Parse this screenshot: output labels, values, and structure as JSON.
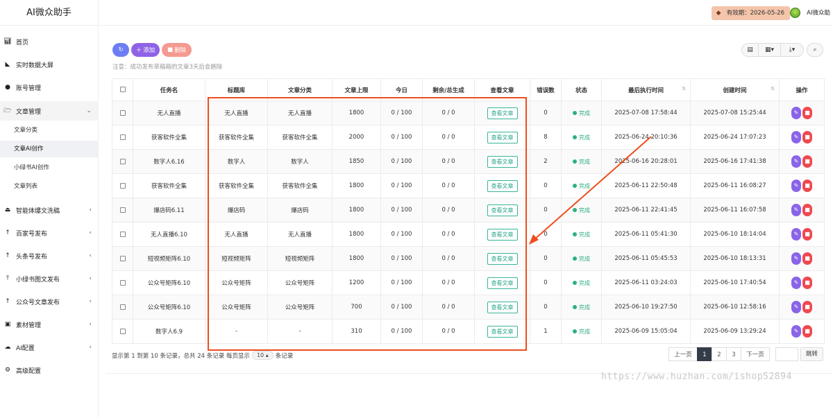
{
  "app": {
    "title": "AI微众助手"
  },
  "topbar": {
    "expiry_label": "有效期：2026-05-26",
    "username": "AI微众助"
  },
  "sidebar": {
    "items": [
      {
        "label": "首页",
        "icon": "bar-chart-icon"
      },
      {
        "label": "实时数据大屏",
        "icon": "area-chart-icon"
      },
      {
        "label": "账号管理",
        "icon": "wechat-icon"
      },
      {
        "label": "文章管理",
        "icon": "folder-open-icon"
      },
      {
        "label": "智能体爆文洗稿",
        "icon": "eject-icon"
      },
      {
        "label": "百家号发布",
        "icon": "arrow-up-icon"
      },
      {
        "label": "头条号发布",
        "icon": "arrow-up-icon"
      },
      {
        "label": "小绿书图文发布",
        "icon": "upload-icon"
      },
      {
        "label": "公众号文章发布",
        "icon": "arrow-up-icon"
      },
      {
        "label": "素材管理",
        "icon": "image-icon"
      },
      {
        "label": "AI配置",
        "icon": "cloud-icon"
      },
      {
        "label": "高级配置",
        "icon": "gear-icon"
      }
    ],
    "sub_items": [
      "文章分类",
      "文章AI创作",
      "小绿书AI创作",
      "文章列表"
    ]
  },
  "toolbar": {
    "add_label": "添加",
    "delete_label": "删除",
    "notice": "注意：成功发布草稿箱的文章3天后会删除"
  },
  "table": {
    "headers": [
      "任务名",
      "标题库",
      "文章分类",
      "文章上限",
      "今日",
      "剩余/总生成",
      "查看文章",
      "错误数",
      "状态",
      "最后执行时间",
      "创建时间",
      "操作"
    ],
    "view_label": "查看文章",
    "rows": [
      {
        "name": "无人直播",
        "title_lib": "无人直播",
        "category": "无人直播",
        "limit": "1800",
        "today": "0 / 100",
        "remain": "0 / 0",
        "errors": "0",
        "status": "完成",
        "last_run": "2025-07-08 17:58:44",
        "created": "2025-07-08 15:25:44"
      },
      {
        "name": "获客软件全集",
        "title_lib": "获客软件全集",
        "category": "获客软件全集",
        "limit": "2000",
        "today": "0 / 100",
        "remain": "0 / 0",
        "errors": "8",
        "status": "完成",
        "last_run": "2025-06-24 20:10:36",
        "created": "2025-06-24 17:07:23"
      },
      {
        "name": "数字人6.16",
        "title_lib": "数字人",
        "category": "数字人",
        "limit": "1850",
        "today": "0 / 100",
        "remain": "0 / 0",
        "errors": "2",
        "status": "完成",
        "last_run": "2025-06-16 20:28:01",
        "created": "2025-06-16 17:41:38"
      },
      {
        "name": "获客软件全集",
        "title_lib": "获客软件全集",
        "category": "获客软件全集",
        "limit": "1800",
        "today": "0 / 100",
        "remain": "0 / 0",
        "errors": "0",
        "status": "完成",
        "last_run": "2025-06-11 22:50:48",
        "created": "2025-06-11 16:08:27"
      },
      {
        "name": "爆店码6.11",
        "title_lib": "爆店码",
        "category": "爆店码",
        "limit": "1800",
        "today": "0 / 100",
        "remain": "0 / 0",
        "errors": "0",
        "status": "完成",
        "last_run": "2025-06-11 22:41:45",
        "created": "2025-06-11 16:07:58"
      },
      {
        "name": "无人直播6.10",
        "title_lib": "无人直播",
        "category": "无人直播",
        "limit": "1800",
        "today": "0 / 100",
        "remain": "0 / 0",
        "errors": "0",
        "status": "完成",
        "last_run": "2025-06-11 05:41:30",
        "created": "2025-06-10 18:14:04"
      },
      {
        "name": "短视频矩阵6.10",
        "title_lib": "短视频矩阵",
        "category": "短视频矩阵",
        "limit": "1800",
        "today": "0 / 100",
        "remain": "0 / 0",
        "errors": "0",
        "status": "完成",
        "last_run": "2025-06-11 05:45:53",
        "created": "2025-06-10 18:13:31"
      },
      {
        "name": "公众号矩阵6.10",
        "title_lib": "公众号矩阵",
        "category": "公众号矩阵",
        "limit": "1200",
        "today": "0 / 100",
        "remain": "0 / 0",
        "errors": "0",
        "status": "完成",
        "last_run": "2025-06-11 03:24:03",
        "created": "2025-06-10 17:40:54"
      },
      {
        "name": "公众号矩阵6.10",
        "title_lib": "公众号矩阵",
        "category": "公众号矩阵",
        "limit": "700",
        "today": "0 / 100",
        "remain": "0 / 0",
        "errors": "0",
        "status": "完成",
        "last_run": "2025-06-10 19:27:50",
        "created": "2025-06-10 12:58:16"
      },
      {
        "name": "数字人6.9",
        "title_lib": "-",
        "category": "-",
        "limit": "310",
        "today": "0 / 100",
        "remain": "0 / 0",
        "errors": "1",
        "status": "完成",
        "last_run": "2025-06-09 15:05:04",
        "created": "2025-06-09 13:29:24"
      }
    ]
  },
  "footer": {
    "info_prefix": "显示第 1 到第 10 条记录，总共 24 条记录 每页显示",
    "page_size": "10",
    "info_suffix": "条记录",
    "prev": "上一页",
    "pages": [
      "1",
      "2",
      "3"
    ],
    "active_page": "1",
    "next": "下一页",
    "jump": "跳转"
  },
  "watermark": "https://www.huzhan.com/ishop52894",
  "colors": {
    "accent_purple": "#8f63e6",
    "accent_blue": "#6d7ef4",
    "danger": "#f0484f",
    "success": "#2cb07e",
    "annotation": "#ee4d1d"
  }
}
